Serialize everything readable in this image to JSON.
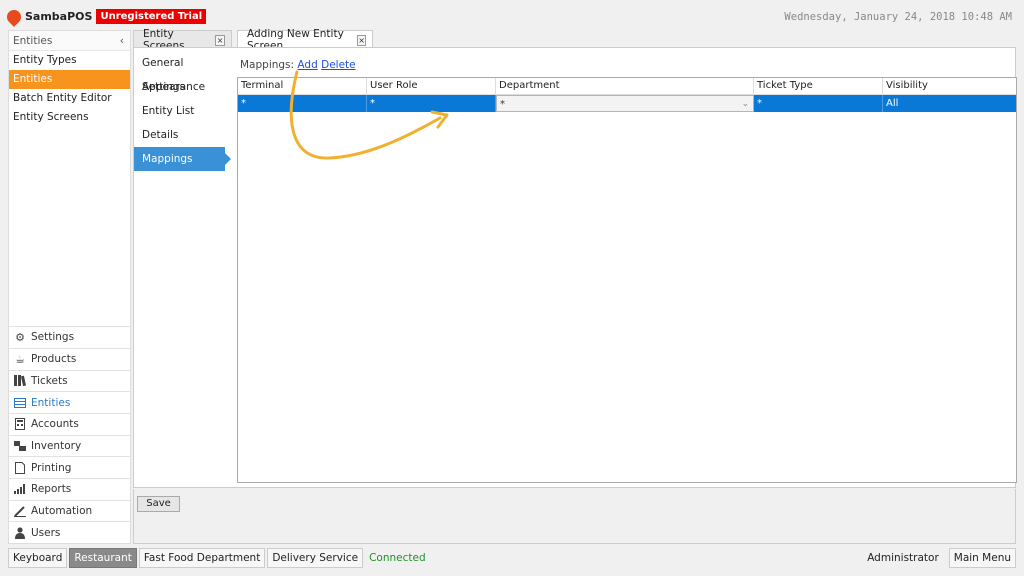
{
  "app": {
    "logo_text": "SambaPOS",
    "trial_badge": "Unregistered Trial",
    "datetime": "Wednesday, January 24, 2018 10:48 AM",
    "accent_color": "#f7941d",
    "selection_color": "#0a78d7"
  },
  "left_panel": {
    "header": "Entities",
    "collapse_glyph": "‹",
    "items": [
      {
        "label": "Entity Types",
        "active": false
      },
      {
        "label": "Entities",
        "active": true
      },
      {
        "label": "Batch Entity Editor",
        "active": false
      },
      {
        "label": "Entity Screens",
        "active": false
      }
    ],
    "nav": [
      {
        "label": "Settings",
        "icon": "gear-icon"
      },
      {
        "label": "Products",
        "icon": "cup-icon"
      },
      {
        "label": "Tickets",
        "icon": "books-icon"
      },
      {
        "label": "Entities",
        "icon": "table-icon",
        "active": true
      },
      {
        "label": "Accounts",
        "icon": "calculator-icon"
      },
      {
        "label": "Inventory",
        "icon": "boxes-icon"
      },
      {
        "label": "Printing",
        "icon": "document-icon"
      },
      {
        "label": "Reports",
        "icon": "bar-chart-icon"
      },
      {
        "label": "Automation",
        "icon": "wand-icon"
      },
      {
        "label": "Users",
        "icon": "user-icon"
      }
    ]
  },
  "tabs": [
    {
      "label": "Entity Screens",
      "close": "×",
      "active": false
    },
    {
      "label": "Adding New Entity Screen",
      "close": "×",
      "active": true
    }
  ],
  "side_tabs": [
    {
      "label": "General Settings"
    },
    {
      "label": "Appearance"
    },
    {
      "label": "Entity List"
    },
    {
      "label": "Details"
    },
    {
      "label": "Mappings",
      "active": true
    }
  ],
  "mappings": {
    "label": "Mappings:",
    "add_link": "Add",
    "delete_link": "Delete",
    "columns": [
      "Terminal",
      "User Role",
      "Department",
      "Ticket Type",
      "Visibility"
    ],
    "rows": [
      {
        "terminal": "*",
        "user_role": "*",
        "department": "*",
        "ticket_type": "*",
        "visibility": "All"
      }
    ],
    "dropdown_glyph": "⌄"
  },
  "save_button": "Save",
  "footer": {
    "keyboard": "Keyboard",
    "restaurant": "Restaurant",
    "department": "Fast Food Department",
    "delivery": "Delivery Service",
    "status": "Connected",
    "user": "Administrator",
    "main_menu": "Main Menu"
  }
}
